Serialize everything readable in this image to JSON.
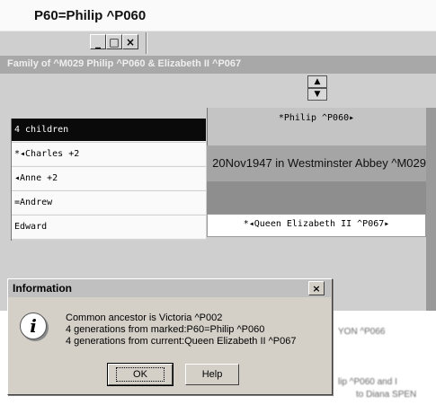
{
  "window": {
    "title": "P60=Philip  ^P060",
    "controls": {
      "minimize": "_",
      "maximize": "□",
      "close": "×"
    }
  },
  "family": {
    "header": "Family of  ^M029 Philip  ^P060 & Elizabeth II ^P067",
    "children_count_label": "4 children",
    "children": [
      {
        "label": "*◂Charles +2"
      },
      {
        "label": "◂Anne +2"
      },
      {
        "label": "=Andrew"
      },
      {
        "label": "Edward"
      }
    ],
    "father": "*Philip  ^P060▸",
    "marriage": "20Nov1947 in Westminster Abbey ^M029",
    "mother": "*◂Queen Elizabeth II  ^P067▸",
    "spin_up": "▲",
    "spin_down": "▼"
  },
  "background_text": {
    "line1": "YON ^P066",
    "line2": "lip  ^P060 and I",
    "line3": "to Diana SPEN"
  },
  "dialog": {
    "title": "Information",
    "close": "×",
    "icon": "i",
    "messages": [
      "Common ancestor is Victoria  ^P002",
      "4 generations from marked:P60=Philip  ^P060",
      "4 generations from current:Queen Elizabeth II  ^P067"
    ],
    "ok_label": "OK",
    "help_label": "Help"
  }
}
